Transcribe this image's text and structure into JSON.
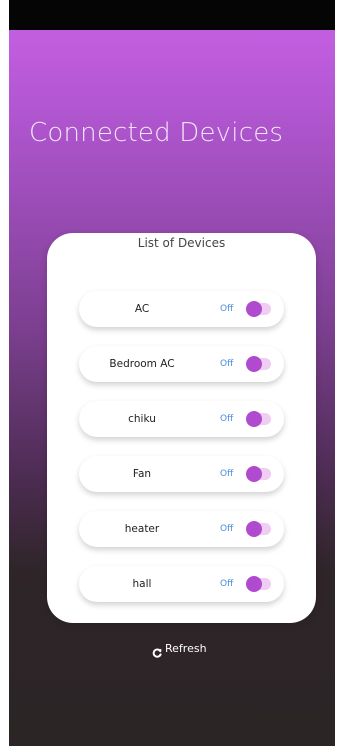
{
  "header": {
    "title": "Connected Devices"
  },
  "device_list": {
    "title": "List of Devices",
    "devices": [
      {
        "name": "AC",
        "status": "Off"
      },
      {
        "name": "Bedroom AC",
        "status": "Off"
      },
      {
        "name": "chiku",
        "status": "Off"
      },
      {
        "name": "Fan",
        "status": "Off"
      },
      {
        "name": "heater",
        "status": "Off"
      },
      {
        "name": "hall",
        "status": "Off"
      }
    ]
  },
  "footer": {
    "refresh_label": "Refresh",
    "refresh_icon": "refresh-icon"
  },
  "colors": {
    "gradient_top": "#c25fe0",
    "gradient_bottom": "#2b2526",
    "toggle_knob": "#b04bd0",
    "toggle_track": "#f0cdf2",
    "status_text": "#4a8ce0"
  }
}
